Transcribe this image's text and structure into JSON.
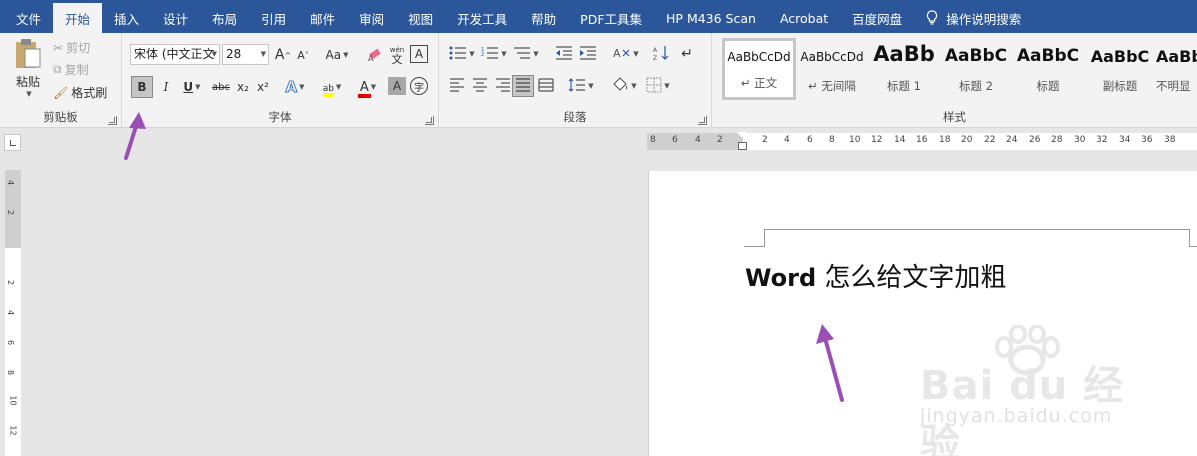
{
  "tabs": [
    "文件",
    "开始",
    "插入",
    "设计",
    "布局",
    "引用",
    "邮件",
    "审阅",
    "视图",
    "开发工具",
    "帮助",
    "PDF工具集",
    "HP M436 Scan",
    "Acrobat",
    "百度网盘",
    "操作说明搜索"
  ],
  "active_tab": "开始",
  "clipboard": {
    "paste_label": "粘贴",
    "cut_label": "剪切",
    "copy_label": "复制",
    "format_painter_label": "格式刷",
    "group_label": "剪贴板"
  },
  "font": {
    "font_name": "宋体 (中文正文",
    "font_size": "28",
    "group_label": "字体",
    "phonetic_top": "wén",
    "phonetic_bottom": "文",
    "border_char": "A",
    "grow_char": "A",
    "shrink_char": "A",
    "case_label": "Aa",
    "bold_label": "B",
    "italic_label": "I",
    "underline_label": "U",
    "strike_label": "abc",
    "subscript_label": "x₂",
    "superscript_label": "x²",
    "effects_char": "A",
    "highlight_char": "ab",
    "font_color_char": "A",
    "shading_char": "A",
    "enclose_char": "字",
    "highlight_color": "#ffff00",
    "font_color": "#e00000"
  },
  "paragraph": {
    "group_label": "段落"
  },
  "styles": {
    "group_label": "样式",
    "items": [
      {
        "sample": "AaBbCcDd",
        "name": "↵ 正文"
      },
      {
        "sample": "AaBbCcDd",
        "name": "↵ 无间隔"
      },
      {
        "sample": "AaBb",
        "name": "标题 1"
      },
      {
        "sample": "AaBbC",
        "name": "标题 2"
      },
      {
        "sample": "AaBbC",
        "name": "标题"
      },
      {
        "sample": "AaBbC",
        "name": "副标题"
      },
      {
        "sample": "AaBbC",
        "name": "不明显"
      }
    ]
  },
  "ruler": {
    "left_numbers": [
      "8",
      "6",
      "4",
      "2"
    ],
    "right_numbers": [
      "2",
      "4",
      "6",
      "8",
      "10",
      "12",
      "14",
      "16",
      "18",
      "20",
      "22",
      "24",
      "26",
      "28",
      "30",
      "32",
      "34",
      "36",
      "38"
    ],
    "vertical_numbers": [
      "4",
      "2",
      "2",
      "4",
      "6",
      "8",
      "10",
      "12"
    ]
  },
  "document": {
    "text_bold": "Word",
    "text_normal": " 怎么给文字加粗"
  },
  "watermark": {
    "main": "Bai du 经验",
    "sub": "jingyan.baidu.com"
  },
  "colors": {
    "brand": "#2b579a",
    "arrow": "#9b4fb5"
  }
}
